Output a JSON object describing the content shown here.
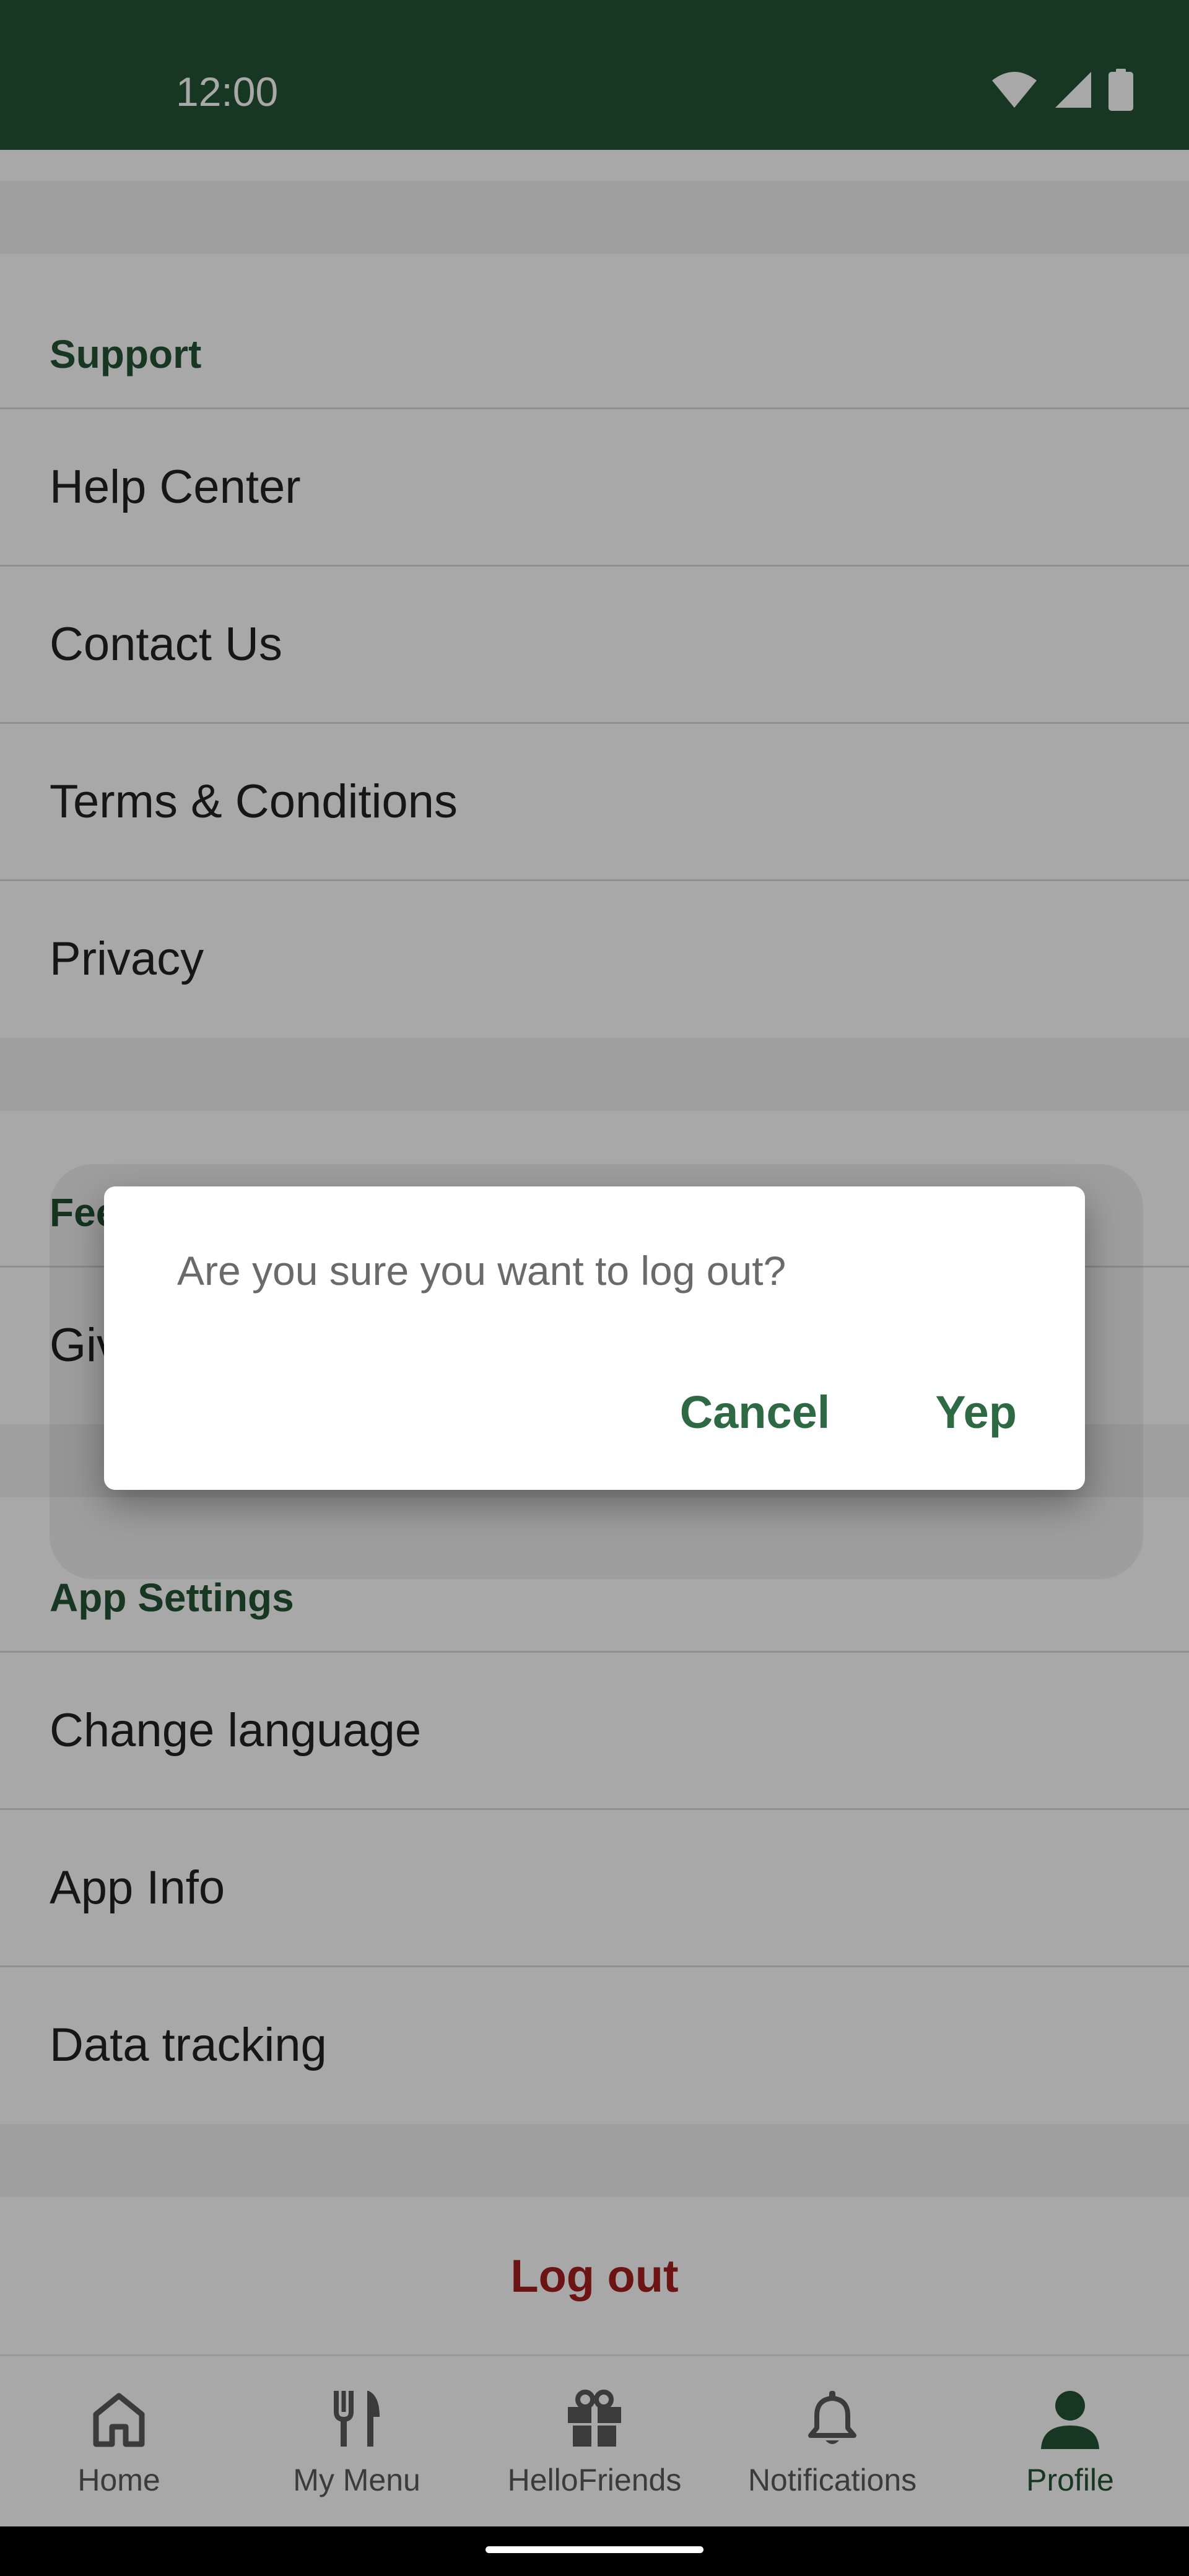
{
  "status_bar": {
    "time": "12:00",
    "icons": [
      "wifi-icon",
      "signal-icon",
      "battery-icon"
    ]
  },
  "sections": {
    "support": {
      "header": "Support",
      "items": [
        "Help Center",
        "Contact Us",
        "Terms & Conditions",
        "Privacy"
      ]
    },
    "feedback": {
      "header": "Feedback",
      "items": [
        "Give feedback"
      ]
    },
    "app_settings": {
      "header": "App Settings",
      "items": [
        "Change language",
        "App Info",
        "Data tracking"
      ]
    }
  },
  "logout": {
    "label": "Log out"
  },
  "bottom_nav": {
    "items": [
      {
        "label": "Home",
        "icon": "home-icon"
      },
      {
        "label": "My Menu",
        "icon": "fork-knife-icon"
      },
      {
        "label": "HelloFriends",
        "icon": "gift-icon"
      },
      {
        "label": "Notifications",
        "icon": "bell-icon"
      },
      {
        "label": "Profile",
        "icon": "person-icon"
      }
    ],
    "active": "Profile"
  },
  "dialog": {
    "message": "Are you sure you want to log out?",
    "cancel_label": "Cancel",
    "confirm_label": "Yep"
  },
  "colors": {
    "brand_green": "#255434",
    "button_green": "#2d6a44",
    "logout_red": "#a41e1e",
    "section_gap": "#f2f2f2"
  }
}
